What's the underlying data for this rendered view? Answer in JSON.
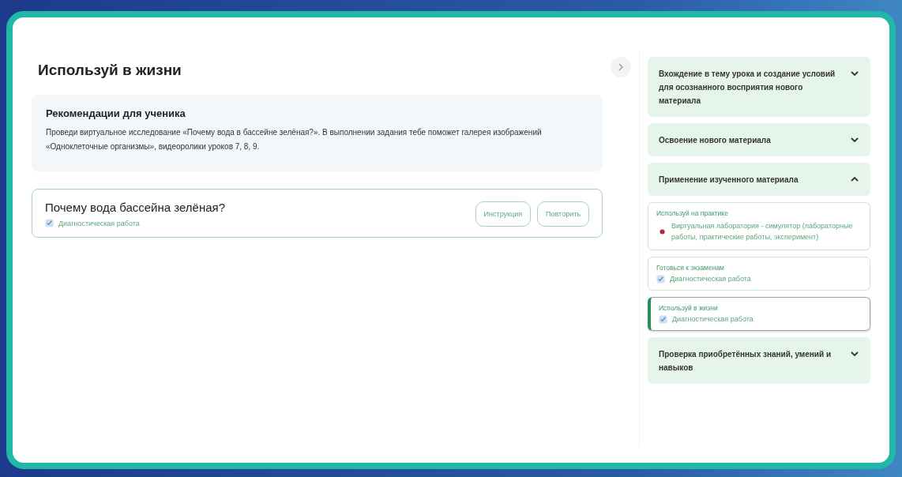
{
  "page": {
    "title": "Используй в жизни"
  },
  "recommendation": {
    "title": "Рекомендации для ученика",
    "text": "Проведи виртуальное исследование «Почему вода в бассейне зелёная?». В выполнении задания тебе поможет галерея изображений «Одноклеточные организмы», видеоролики уроков 7, 8, 9."
  },
  "task": {
    "title": "Почему вода бассейна зелёная?",
    "type": "Диагностическая работа",
    "buttons": [
      "Инструкция",
      "Повторить"
    ]
  },
  "sidebar": {
    "sections": [
      {
        "title": "Вхождение в тему урока и создание условий для осознанного восприятия нового материала",
        "expanded": false
      },
      {
        "title": "Освоение нового материала",
        "expanded": false
      },
      {
        "title": "Применение изученного материала",
        "expanded": true,
        "items": [
          {
            "heading": "Используй на практике",
            "selected": false,
            "entries": [
              {
                "kind": "lab",
                "label": "Виртуальная лаборатория - симулятор (лабораторные работы, практические работы, эксперимент)"
              }
            ]
          },
          {
            "heading": "Готовься к экзаменам",
            "selected": false,
            "entries": [
              {
                "kind": "test",
                "label": "Диагностическая работа"
              }
            ]
          },
          {
            "heading": "Используй в жизни",
            "selected": true,
            "entries": [
              {
                "kind": "test",
                "label": "Диагностическая работа"
              }
            ]
          }
        ]
      },
      {
        "title": "Проверка приобретённых знаний, умений и навыков",
        "expanded": false
      }
    ]
  }
}
